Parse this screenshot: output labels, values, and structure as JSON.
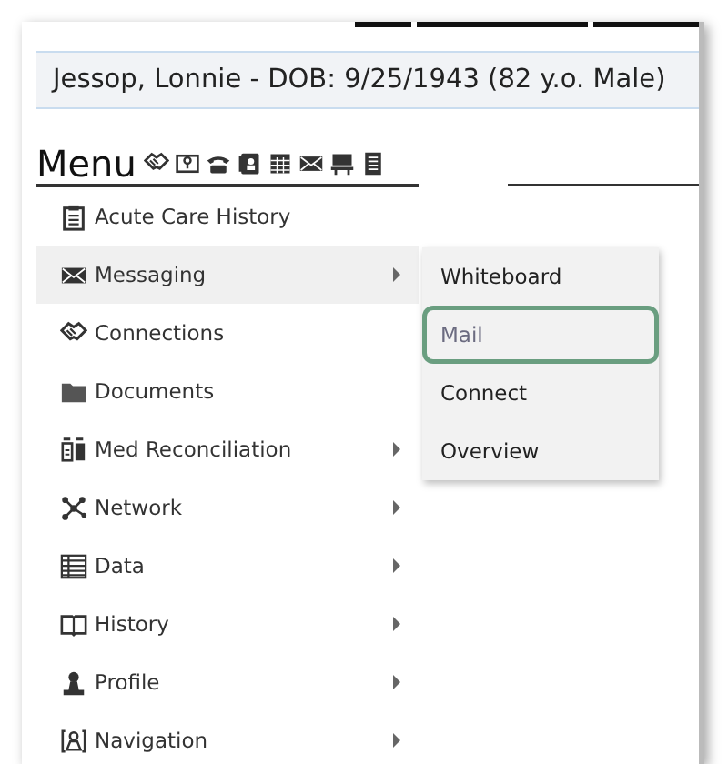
{
  "patient_banner": {
    "text": "Jessop, Lonnie - DOB: 9/25/1943 (82 y.o. Male)"
  },
  "menu": {
    "title": "Menu",
    "items": [
      {
        "label": "Acute Care History",
        "has_submenu": false,
        "expanded": false
      },
      {
        "label": "Messaging",
        "has_submenu": true,
        "expanded": true
      },
      {
        "label": "Connections",
        "has_submenu": false,
        "expanded": false
      },
      {
        "label": "Documents",
        "has_submenu": false,
        "expanded": false
      },
      {
        "label": "Med Reconciliation",
        "has_submenu": true,
        "expanded": false
      },
      {
        "label": "Network",
        "has_submenu": true,
        "expanded": false
      },
      {
        "label": "Data",
        "has_submenu": true,
        "expanded": false
      },
      {
        "label": "History",
        "has_submenu": true,
        "expanded": false
      },
      {
        "label": "Profile",
        "has_submenu": true,
        "expanded": false
      },
      {
        "label": "Navigation",
        "has_submenu": true,
        "expanded": false
      }
    ]
  },
  "submenu": {
    "items": [
      {
        "label": "Whiteboard",
        "selected": false
      },
      {
        "label": "Mail",
        "selected": true
      },
      {
        "label": "Connect",
        "selected": false
      },
      {
        "label": "Overview",
        "selected": false
      }
    ]
  }
}
